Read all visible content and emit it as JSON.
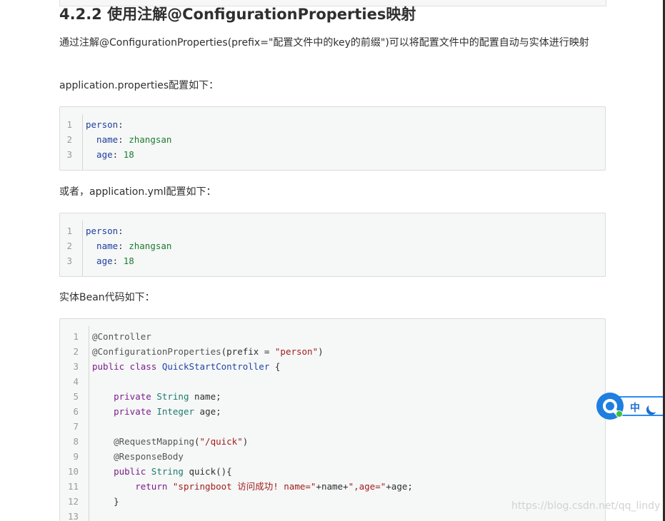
{
  "heading": "4.2.2 使用注解@ConfigurationProperties映射",
  "intro_text": "通过注解@ConfigurationProperties(prefix=\"配置文件中的key的前缀\")可以将配置文件中的配置自动与实体进行映射",
  "properties_label": "application.properties配置如下：",
  "yml_label": "或者，application.yml配置如下：",
  "bean_label": "实体Bean代码如下：",
  "properties_code": {
    "lines": [
      {
        "n": "1",
        "key": "person",
        "sep": ":",
        "val": ""
      },
      {
        "n": "2",
        "key": "  name",
        "sep": ": ",
        "val": "zhangsan"
      },
      {
        "n": "3",
        "key": "  age",
        "sep": ": ",
        "val": "18"
      }
    ]
  },
  "yml_code": {
    "lines": [
      {
        "n": "1",
        "key": "person",
        "sep": ":",
        "val": ""
      },
      {
        "n": "2",
        "key": "  name",
        "sep": ": ",
        "val": "zhangsan"
      },
      {
        "n": "3",
        "key": "  age",
        "sep": ": ",
        "val": "18"
      }
    ]
  },
  "bean_code": {
    "lines": [
      {
        "n": "1",
        "tokens": [
          [
            "ann",
            "@Controller"
          ]
        ]
      },
      {
        "n": "2",
        "tokens": [
          [
            "ann",
            "@ConfigurationProperties"
          ],
          [
            "plain",
            "(prefix = "
          ],
          [
            "str",
            "\"person\""
          ],
          [
            "plain",
            ")"
          ]
        ]
      },
      {
        "n": "3",
        "tokens": [
          [
            "kw",
            "public class "
          ],
          [
            "cls",
            "QuickStartController"
          ],
          [
            "plain",
            " {"
          ]
        ]
      },
      {
        "n": "4",
        "tokens": []
      },
      {
        "n": "5",
        "tokens": [
          [
            "plain",
            "    "
          ],
          [
            "kw",
            "private "
          ],
          [
            "type",
            "String"
          ],
          [
            "plain",
            " name;"
          ]
        ]
      },
      {
        "n": "6",
        "tokens": [
          [
            "plain",
            "    "
          ],
          [
            "kw",
            "private "
          ],
          [
            "type",
            "Integer"
          ],
          [
            "plain",
            " age;"
          ]
        ]
      },
      {
        "n": "7",
        "tokens": []
      },
      {
        "n": "8",
        "tokens": [
          [
            "plain",
            "    "
          ],
          [
            "ann",
            "@RequestMapping"
          ],
          [
            "plain",
            "("
          ],
          [
            "str",
            "\"/quick\""
          ],
          [
            "plain",
            ")"
          ]
        ]
      },
      {
        "n": "9",
        "tokens": [
          [
            "plain",
            "    "
          ],
          [
            "ann",
            "@ResponseBody"
          ]
        ]
      },
      {
        "n": "10",
        "tokens": [
          [
            "plain",
            "    "
          ],
          [
            "kw",
            "public "
          ],
          [
            "type",
            "String"
          ],
          [
            "plain",
            " quick(){"
          ]
        ]
      },
      {
        "n": "11",
        "tokens": [
          [
            "plain",
            "        "
          ],
          [
            "kw",
            "return "
          ],
          [
            "str",
            "\"springboot 访问成功! name=\""
          ],
          [
            "plain",
            "+name+"
          ],
          [
            "str",
            "\",age=\""
          ],
          [
            "plain",
            "+age;"
          ]
        ]
      },
      {
        "n": "12",
        "tokens": [
          [
            "plain",
            "    }"
          ]
        ]
      },
      {
        "n": "13",
        "tokens": []
      }
    ]
  },
  "widget": {
    "label": "中",
    "logo_icon": "q-logo-icon",
    "moon_icon": "moon-icon",
    "status_color": "#3bc23b",
    "accent_color": "#1e7fe0"
  },
  "watermark": "https://blog.csdn.net/qq_lindy"
}
